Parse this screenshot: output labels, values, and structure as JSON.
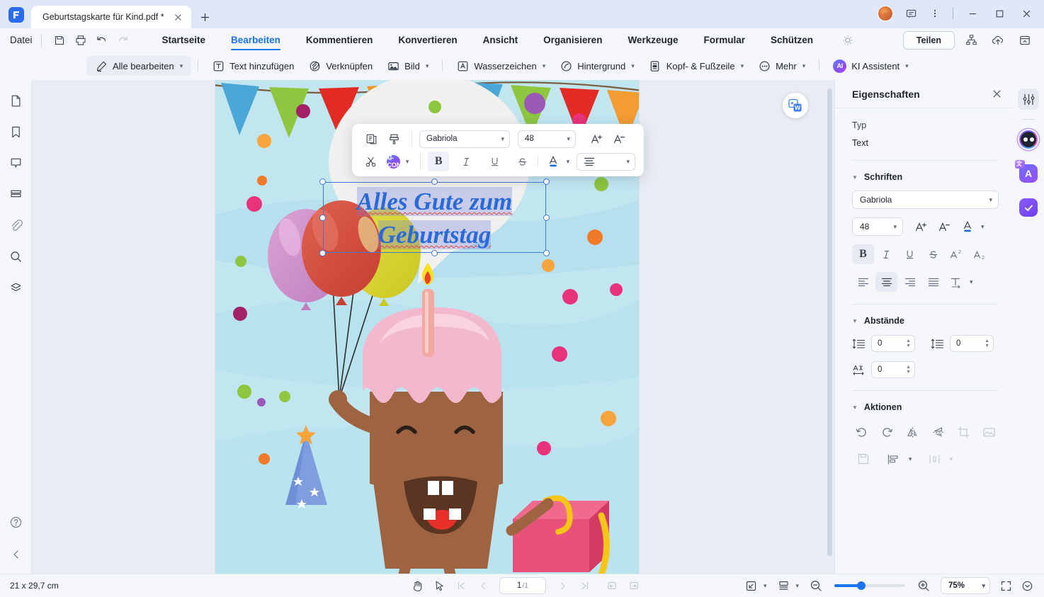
{
  "window": {
    "tab_title": "Geburtstagskarte für Kind.pdf *",
    "new_tab_label": "+",
    "close_tab_label": "×",
    "minimize_label": "—",
    "maximize_label": "□",
    "close_label": "✕"
  },
  "menubar": {
    "file_label": "Datei",
    "quick_icons": [
      "save-icon",
      "print-icon",
      "undo-icon",
      "redo-icon"
    ],
    "tabs": [
      {
        "label": "Startseite",
        "active": false
      },
      {
        "label": "Bearbeiten",
        "active": true
      },
      {
        "label": "Kommentieren",
        "active": false
      },
      {
        "label": "Konvertieren",
        "active": false
      },
      {
        "label": "Ansicht",
        "active": false
      },
      {
        "label": "Organisieren",
        "active": false
      },
      {
        "label": "Werkzeuge",
        "active": false
      },
      {
        "label": "Formular",
        "active": false
      },
      {
        "label": "Schützen",
        "active": false
      }
    ],
    "share_label": "Teilen"
  },
  "ribbon": {
    "edit_all_label": "Alle bearbeiten",
    "items": [
      {
        "label": "Text hinzufügen",
        "icon": "add-text-icon",
        "caret": false
      },
      {
        "label": "Verknüpfen",
        "icon": "link-icon",
        "caret": false
      },
      {
        "label": "Bild",
        "icon": "image-icon",
        "caret": true
      },
      {
        "label": "Wasserzeichen",
        "icon": "watermark-icon",
        "caret": true
      },
      {
        "label": "Hintergrund",
        "icon": "background-icon",
        "caret": true
      },
      {
        "label": "Kopf- & Fußzeile",
        "icon": "header-footer-icon",
        "caret": true
      },
      {
        "label": "Mehr",
        "icon": "more-dots-icon",
        "caret": true
      }
    ],
    "ai_assistant_label": "KI Assistent",
    "ai_badge_label": "AI"
  },
  "left_rail": {
    "items": [
      {
        "name": "thumbnails-icon"
      },
      {
        "name": "bookmark-icon"
      },
      {
        "name": "comment-icon"
      },
      {
        "name": "layers-icon"
      },
      {
        "name": "attachment-icon"
      },
      {
        "name": "search-icon"
      },
      {
        "name": "stamp-icon"
      }
    ],
    "help_label": "?",
    "collapse_label": "‹"
  },
  "document": {
    "card_text_line1": "Alles Gute zum",
    "card_text_line2": "Geburtstag",
    "convert_to_word_label": "W"
  },
  "float_toolbar": {
    "font": "Gabriola",
    "size": "48",
    "align": "center",
    "icons_row1": [
      "copy-icon",
      "format-painter-icon"
    ],
    "icons_row2": [
      "cut-icon",
      "ai-icon"
    ],
    "bold_label": "B",
    "italic_label": "I",
    "underline_label": "U",
    "strikethrough_label": "S",
    "font_color_label": "A",
    "increase_size_label": "A",
    "decrease_size_label": "A"
  },
  "properties": {
    "title": "Eigenschaften",
    "type_label": "Typ",
    "type_value": "Text",
    "fonts_section": "Schriften",
    "font_name": "Gabriola",
    "font_size": "48",
    "bold_label": "B",
    "italic_label": "I",
    "underline_label": "U",
    "strike_label": "S",
    "superscript_label": "A",
    "subscript_label": "A",
    "spacing_section": "Abstände",
    "line_spacing_value": "0",
    "paragraph_spacing_value": "0",
    "char_spacing_value": "0",
    "actions_section": "Aktionen"
  },
  "right_rail": {
    "items": [
      {
        "name": "properties-sliders-icon",
        "selected": true
      },
      {
        "name": "ai-robot-icon",
        "selected": false
      },
      {
        "name": "translate-icon",
        "selected": false
      },
      {
        "name": "check-tasks-icon",
        "selected": false
      }
    ]
  },
  "statusbar": {
    "page_dimensions": "21 x 29,7 cm",
    "current_page": "1",
    "total_pages": "/1",
    "zoom_level": "75%",
    "hand_tool": "hand-tool-icon",
    "select_tool": "select-tool-icon"
  },
  "colors": {
    "accent": "#1a73f0",
    "title_bar": "#dfe8f7",
    "panel_bg": "#f5f7fb",
    "card_sky": "#c4e8f2",
    "card_text": "#2a6ad6",
    "spell_error": "#e04545",
    "selection": "rgba(120,130,220,.33)"
  }
}
